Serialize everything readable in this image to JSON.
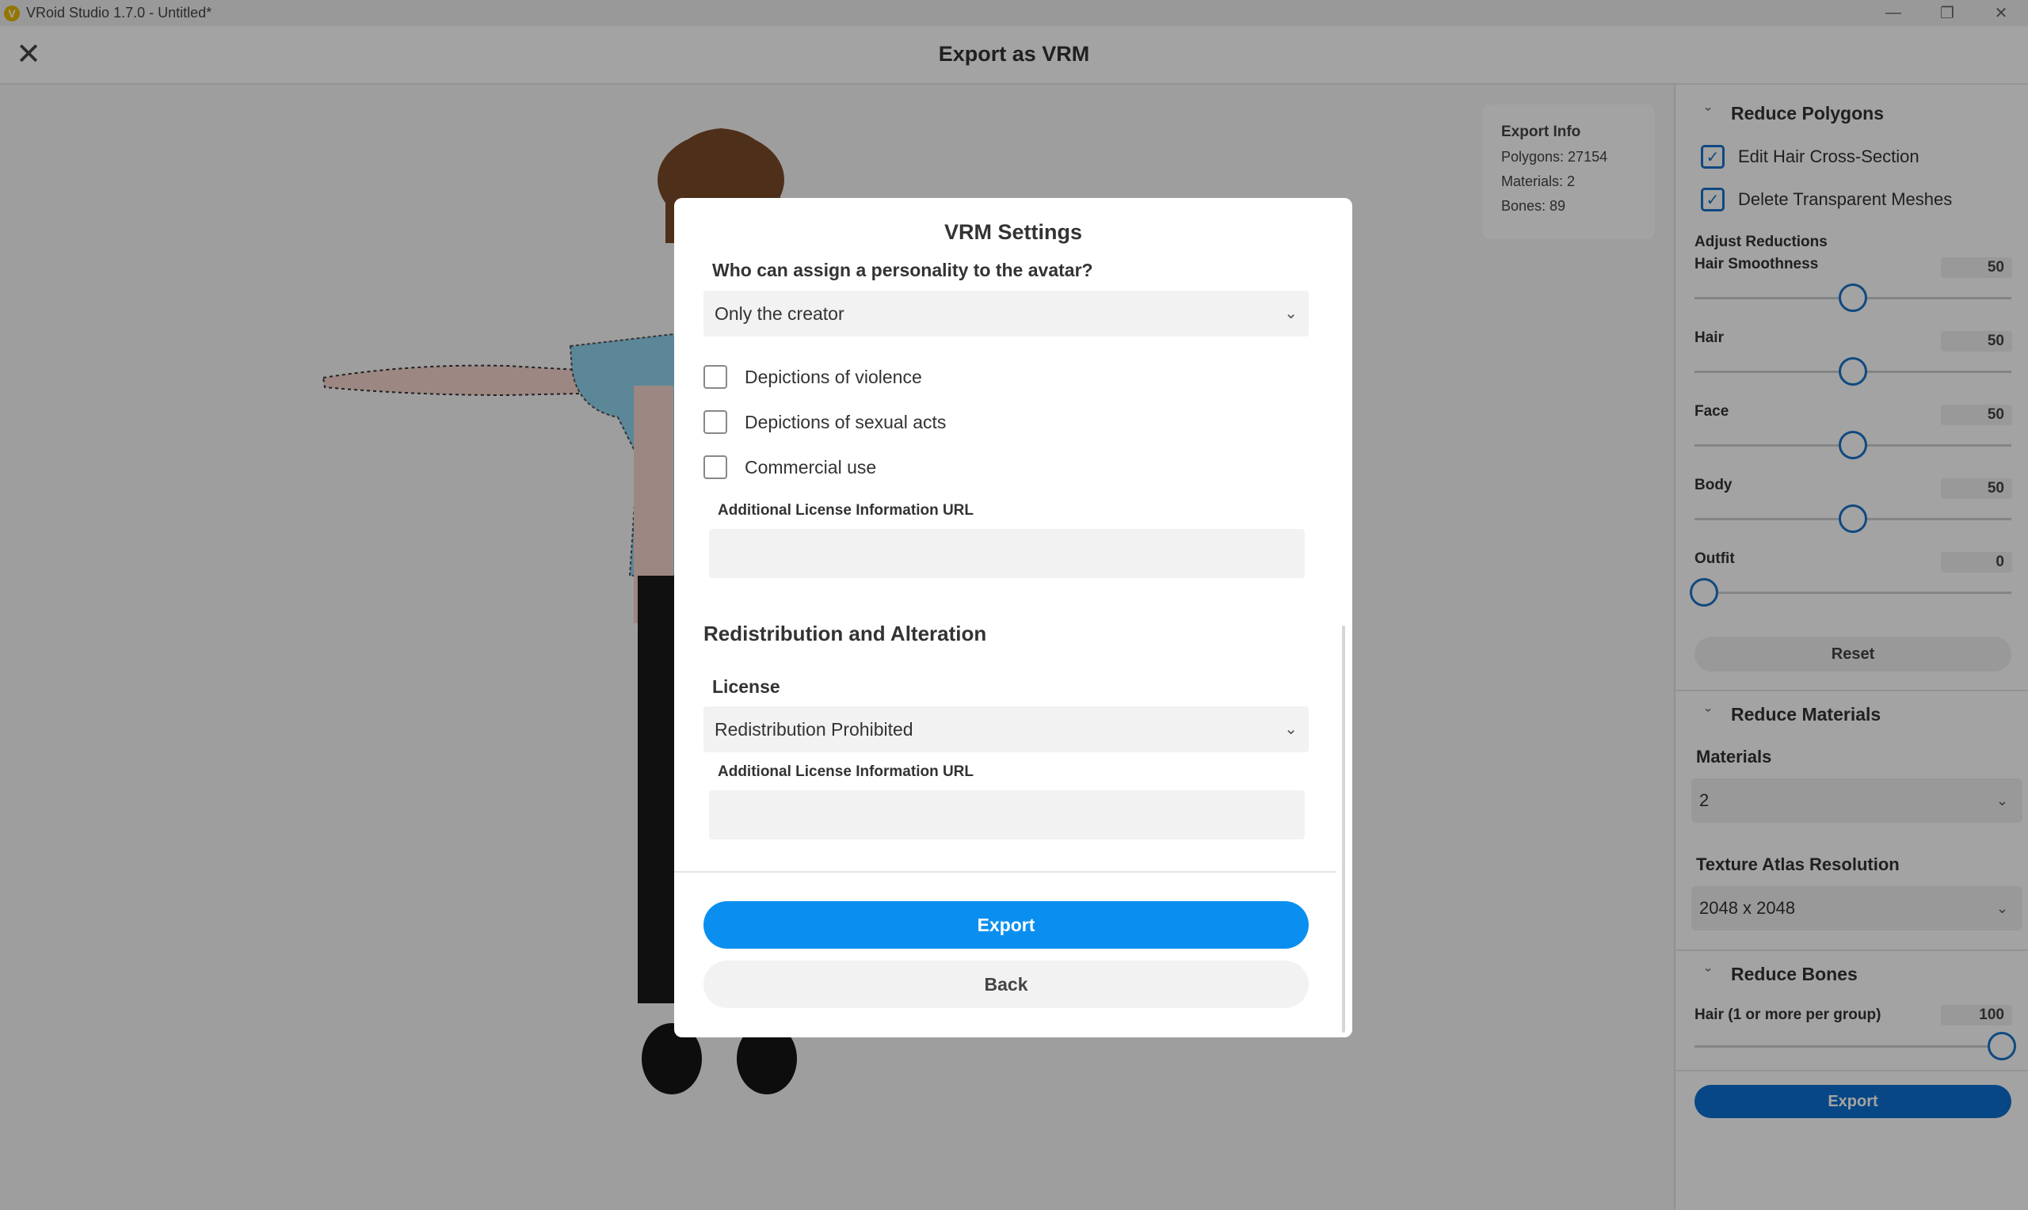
{
  "window": {
    "title": "VRoid Studio 1.7.0 - Untitled*",
    "app_icon_letter": "V",
    "minimize_glyph": "—",
    "restore_glyph": "❐",
    "close_glyph": "✕"
  },
  "header": {
    "close_glyph": "✕",
    "title": "Export as VRM"
  },
  "export_info": {
    "title": "Export Info",
    "polygons": "Polygons: 27154",
    "materials": "Materials: 2",
    "bones": "Bones: 89"
  },
  "panel": {
    "reduce_polygons": {
      "title": "Reduce Polygons",
      "edit_hair": "Edit Hair Cross-Section",
      "edit_hair_checked": true,
      "delete_transparent": "Delete Transparent Meshes",
      "delete_transparent_checked": true,
      "adjust_reductions": "Adjust Reductions",
      "sliders": [
        {
          "label": "Hair Smoothness",
          "value": "50",
          "fraction": 0.5
        },
        {
          "label": "Hair",
          "value": "50",
          "fraction": 0.5
        },
        {
          "label": "Face",
          "value": "50",
          "fraction": 0.5
        },
        {
          "label": "Body",
          "value": "50",
          "fraction": 0.5
        },
        {
          "label": "Outfit",
          "value": "0",
          "fraction": 0.0
        }
      ],
      "reset": "Reset"
    },
    "reduce_materials": {
      "title": "Reduce Materials",
      "materials_label": "Materials",
      "materials_value": "2",
      "atlas_label": "Texture Atlas Resolution",
      "atlas_value": "2048 x 2048"
    },
    "reduce_bones": {
      "title": "Reduce Bones",
      "hair_label": "Hair (1 or more per group)",
      "hair_value": "100",
      "hair_fraction": 1.0
    },
    "export": "Export"
  },
  "dialog": {
    "title": "VRM Settings",
    "personality_question": "Who can assign a personality to the avatar?",
    "personality_value": "Only the creator",
    "checkboxes": [
      {
        "label": "Depictions of violence",
        "checked": false
      },
      {
        "label": "Depictions of sexual acts",
        "checked": false
      },
      {
        "label": "Commercial use",
        "checked": false
      }
    ],
    "additional_url_label_1": "Additional License Information URL",
    "additional_url_value_1": "",
    "redistribution_title": "Redistribution and Alteration",
    "license_label": "License",
    "license_value": "Redistribution Prohibited",
    "additional_url_label_2": "Additional License Information URL",
    "additional_url_value_2": "",
    "export": "Export",
    "back": "Back"
  },
  "colors": {
    "accent": "#0a8ff0",
    "panel_accent": "#0d6fd0",
    "shirt": "#8fd3ef",
    "pants": "#1a1a1a",
    "hair": "#7a4a2a",
    "skin": "#f4d3cc"
  }
}
